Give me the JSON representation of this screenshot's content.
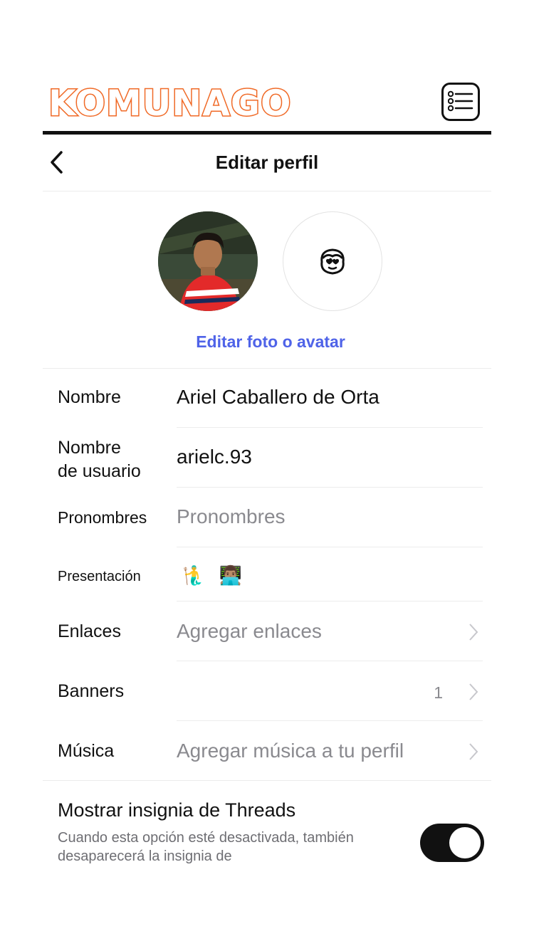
{
  "brand": {
    "logo_text": "KOMUNAGO",
    "accent_color": "#f06a27",
    "menu_icon": "list-icon"
  },
  "nav": {
    "back_icon": "chevron-left-icon",
    "title": "Editar perfil"
  },
  "avatar": {
    "photo_alt": "profile-photo",
    "avatar_icon": "avatar-face-icon",
    "edit_link": "Editar foto o avatar",
    "link_color": "#4f63e8"
  },
  "fields": {
    "name": {
      "label": "Nombre",
      "value": "Ariel Caballero de Orta"
    },
    "username": {
      "label_line1": "Nombre",
      "label_line2": "de usuario",
      "value": "arielc.93"
    },
    "pronouns": {
      "label": "Pronombres",
      "placeholder": "Pronombres"
    },
    "bio": {
      "label": "Presentación",
      "value": "🧜‍♂️ 👨🏽‍💻"
    },
    "links": {
      "label": "Enlaces",
      "placeholder": "Agregar enlaces"
    },
    "banners": {
      "label": "Banners",
      "count": "1"
    },
    "music": {
      "label": "Música",
      "placeholder": "Agregar música a tu perfil"
    }
  },
  "threads_badge": {
    "title": "Mostrar insignia de Threads",
    "description": "Cuando esta opción esté desactivada, también desaparecerá la insignia de",
    "enabled": true
  }
}
